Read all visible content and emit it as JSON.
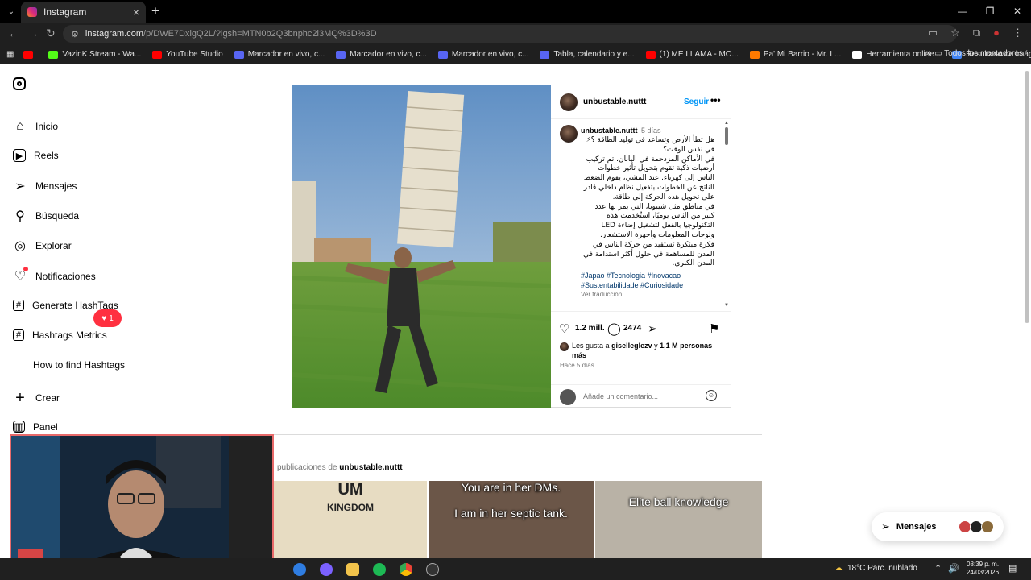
{
  "browser": {
    "tab_title": "Instagram",
    "tab_close": "×",
    "new_tab": "+",
    "url_host": "instagram.com",
    "url_path": "/p/DWE7DxigQ2L/?igsh=MTN0b2Q3bnphc2l3MQ%3D%3D",
    "window_controls": [
      "—",
      "❐",
      "✕"
    ],
    "bookmarks": [
      {
        "label": "",
        "color": "#ff0000"
      },
      {
        "label": "VazinK Stream - Wa...",
        "color": "#53fc18"
      },
      {
        "label": "YouTube Studio",
        "color": "#ff0000"
      },
      {
        "label": "Marcador en vivo, c...",
        "color": "#5865f2"
      },
      {
        "label": "Marcador en vivo, c...",
        "color": "#5865f2"
      },
      {
        "label": "Marcador en vivo, c...",
        "color": "#5865f2"
      },
      {
        "label": "Tabla, calendario y e...",
        "color": "#5865f2"
      },
      {
        "label": "(1) ME LLAMA - MO...",
        "color": "#ff0000"
      },
      {
        "label": "Pa' Mi Barrio - Mr. L...",
        "color": "#ff7a00"
      },
      {
        "label": "Herramienta online...",
        "color": "#ffffff"
      },
      {
        "label": "Resultado de imáge...",
        "color": "#4285f4"
      }
    ],
    "bookmarks_more": "»",
    "all_bookmarks": "Todos los marcadores"
  },
  "sidebar": {
    "items": [
      {
        "label": "Inicio",
        "icon": "⌂"
      },
      {
        "label": "Reels",
        "icon": "▶"
      },
      {
        "label": "Mensajes",
        "icon": "➢"
      },
      {
        "label": "Búsqueda",
        "icon": "⚲"
      },
      {
        "label": "Explorar",
        "icon": "◎"
      },
      {
        "label": "Notificaciones",
        "icon": "♡"
      },
      {
        "label": "Generate HashTags",
        "icon": "#"
      },
      {
        "label": "Hashtags Metrics",
        "icon": "#"
      },
      {
        "label": "How to find Hashtags",
        "icon": ""
      },
      {
        "label": "Crear",
        "icon": "+"
      },
      {
        "label": "Panel",
        "icon": "▥"
      }
    ],
    "notif_count": "1"
  },
  "post": {
    "username": "unbustable.nuttt",
    "follow": "Seguir",
    "more": "•••",
    "caption_time": "5 días",
    "caption_lines": [
      "هل تطأ الأرض وتساعد في توليد الطاقة ؟⚡",
      "في نفس الوقت؟",
      "في الأماكن المزدحمة في اليابان، تم تركيب",
      "أرضيات ذكية تقوم بتحويل تأثير خطوات",
      "الناس إلى كهرباء. عند المشي، يقوم الضغط",
      "الناتج عن الخطوات بتفعيل نظام داخلي قادر",
      "على تحويل هذه الحركة إلى طاقة.",
      "في مناطق مثل شيبويا، التي يمر بها عدد",
      "كبير من الناس يوميًا، استُخدمت هذه",
      "التكنولوجيا بالفعل لتشغيل إضاءة LED",
      "ولوحات المعلومات وأجهزة الاستشعار.",
      "فكرة مبتكرة تستفيد من حركة الناس في",
      "المدن للمساهمة في حلول أكثر استدامة في",
      "المدن الكبرى."
    ],
    "hashtags": "#Japao #Tecnologia #Inovacao #Sustentabilidade #Curiosidade",
    "see_translation": "Ver traducción",
    "likes_count": "1.2 mill.",
    "comments_count": "2474",
    "liked_by_prefix": "Les gusta a",
    "liked_by_user": "giselleglezv",
    "liked_by_and": "y",
    "liked_by_rest": "1,1 M personas más",
    "posted_ago": "Hace 5 días",
    "comment_placeholder": "Añade un comentario..."
  },
  "more_posts": {
    "prefix": "publicaciones de",
    "user": "unbustable.nuttt",
    "thumbs": [
      {
        "line1": "UM",
        "line2": "KINGDOM",
        "bg": "#e7dcc2"
      },
      {
        "line1": "You are in her DMs.",
        "line2": "I am in her septic tank.",
        "bg": "#6b5648"
      },
      {
        "line1": "Elite ball knowledge",
        "line2": "",
        "bg": "#b9b2a6"
      }
    ]
  },
  "messages_pill": {
    "label": "Mensajes"
  },
  "taskbar": {
    "weather": "18°C  Parc. nublado",
    "time": "08:39 p. m.",
    "date": "24/03/2026"
  }
}
